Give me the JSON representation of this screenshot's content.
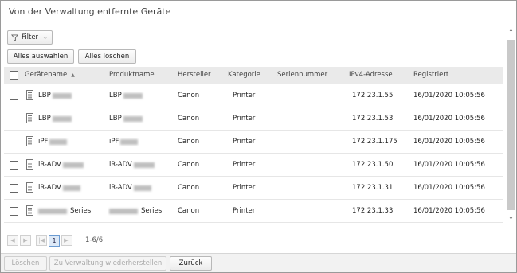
{
  "window": {
    "title": "Von der Verwaltung entfernte Geräte"
  },
  "toolbar": {
    "filter_label": "Filter",
    "select_all_label": "Alles auswählen",
    "clear_all_label": "Alles löschen"
  },
  "table": {
    "columns": [
      "Gerätename",
      "Produktname",
      "Hersteller",
      "Kategorie",
      "Seriennummer",
      "IPv4-Adresse",
      "Registriert"
    ],
    "rows": [
      {
        "name": "LBP",
        "product": "LBP",
        "vendor": "Canon",
        "category": "Printer",
        "serial": "",
        "ip": "172.23.1.55",
        "registered": "16/01/2020 10:05:56"
      },
      {
        "name": "LBP",
        "product": "LBP",
        "vendor": "Canon",
        "category": "Printer",
        "serial": "",
        "ip": "172.23.1.53",
        "registered": "16/01/2020 10:05:56"
      },
      {
        "name": "iPF",
        "product": "iPF",
        "vendor": "Canon",
        "category": "Printer",
        "serial": "",
        "ip": "172.23.1.175",
        "registered": "16/01/2020 10:05:56"
      },
      {
        "name": "iR-ADV",
        "product": "iR-ADV",
        "vendor": "Canon",
        "category": "Printer",
        "serial": "",
        "ip": "172.23.1.50",
        "registered": "16/01/2020 10:05:56"
      },
      {
        "name": "iR-ADV",
        "product": "iR-ADV",
        "vendor": "Canon",
        "category": "Printer",
        "serial": "",
        "ip": "172.23.1.31",
        "registered": "16/01/2020 10:05:56"
      },
      {
        "name": "Series",
        "product": "Series",
        "vendor": "Canon",
        "category": "Printer",
        "serial": "",
        "ip": "172.23.1.33",
        "registered": "16/01/2020 10:05:56"
      }
    ]
  },
  "pager": {
    "current_page": "1",
    "range": "1-6/6"
  },
  "footer": {
    "delete_label": "Löschen",
    "restore_label": "Zu Verwaltung wiederherstellen",
    "back_label": "Zurück"
  },
  "icons": {
    "filter": "funnel-icon",
    "device": "printer-device-icon",
    "sort": "sort-ascending-icon"
  }
}
